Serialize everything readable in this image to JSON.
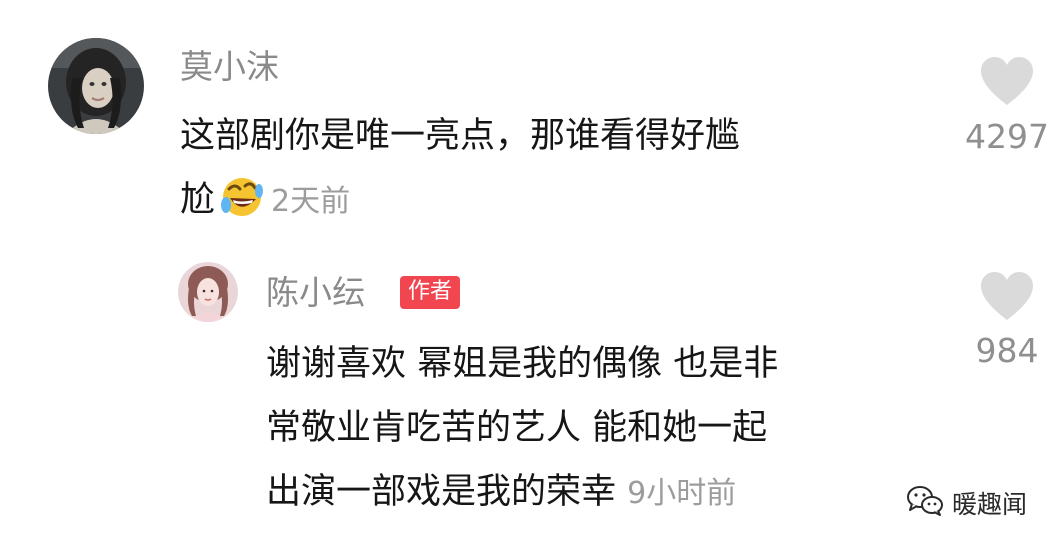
{
  "comments": [
    {
      "username": "莫小沫",
      "text_lines": [
        "这部剧你是唯一亮点，那谁看得好尴",
        "尬"
      ],
      "emoji": "laughing-crying-emoji",
      "timestamp": "2天前",
      "like_count": "4297"
    }
  ],
  "reply": {
    "username": "陈小纭",
    "badge": "作者",
    "text_lines": [
      "谢谢喜欢 幂姐是我的偶像 也是非",
      "常敬业肯吃苦的艺人 能和她一起",
      "出演一部戏是我的荣幸"
    ],
    "timestamp": "9小时前",
    "like_count": "984"
  },
  "watermark": {
    "text": "暖趣闻",
    "icon": "wechat-icon"
  },
  "colors": {
    "badge_bg": "#f1454f",
    "username": "#8a8a8a",
    "timestamp": "#9c9c9c",
    "like_icon": "#dadada"
  }
}
